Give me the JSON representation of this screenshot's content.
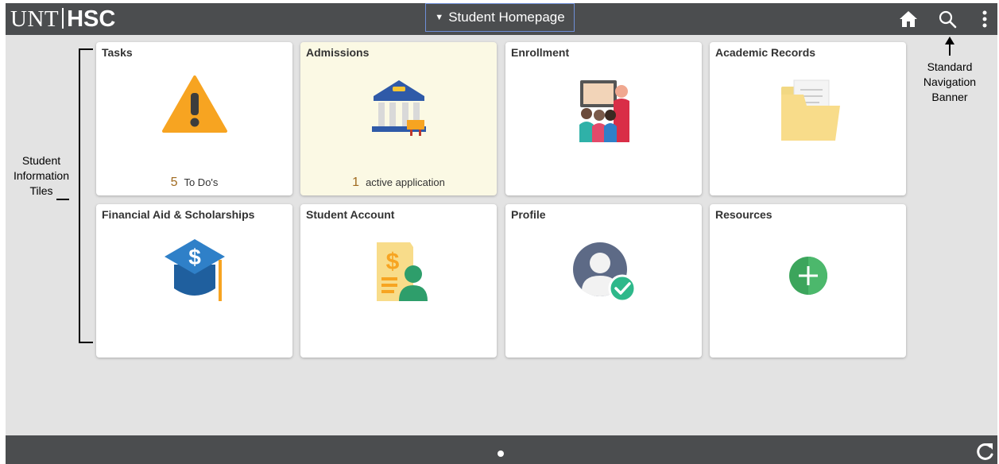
{
  "banner": {
    "logo_left": "UNT",
    "logo_right": "HSC",
    "page_selector": "Student Homepage",
    "home_icon": "home-icon",
    "search_icon": "search-icon",
    "actions_icon": "vertical-ellipsis-icon"
  },
  "tiles": [
    {
      "title": "Tasks",
      "icon": "warning-icon",
      "count": "5",
      "count_label": "To Do's"
    },
    {
      "title": "Admissions",
      "icon": "bank-icon",
      "count": "1",
      "count_label": "active application"
    },
    {
      "title": "Enrollment",
      "icon": "classroom-icon"
    },
    {
      "title": "Academic Records",
      "icon": "folder-icon"
    },
    {
      "title": "Financial Aid & Scholarships",
      "icon": "graduation-cap-dollar-icon"
    },
    {
      "title": "Student Account",
      "icon": "bill-user-icon"
    },
    {
      "title": "Profile",
      "icon": "user-check-icon"
    },
    {
      "title": "Resources",
      "icon": "plus-circle-icon"
    }
  ],
  "annotations": {
    "tiles_label": [
      "Student",
      "Information",
      "Tiles"
    ],
    "banner_label": [
      "Standard",
      "Navigation",
      "Banner"
    ]
  },
  "footer": {
    "refresh_icon": "refresh-icon"
  },
  "colors": {
    "banner": "#4b4d4f",
    "background": "#e3e3e3",
    "tile": "#ffffff",
    "tile_highlight": "#fbf9e4",
    "count": "#a06a1f"
  }
}
